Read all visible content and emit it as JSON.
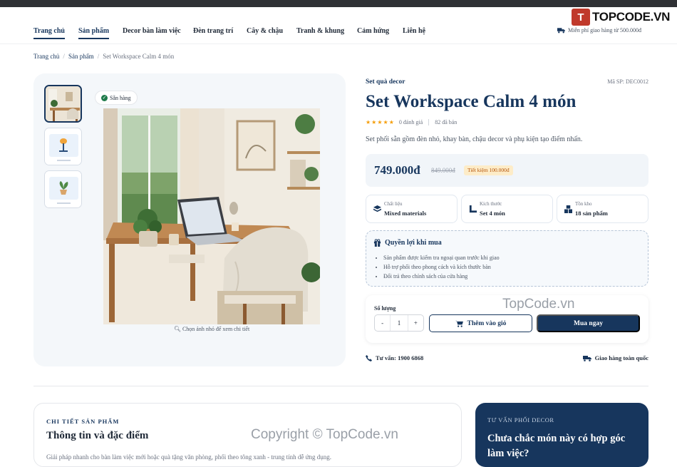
{
  "logo": {
    "mark": "T",
    "text": "TOPCODE.VN"
  },
  "nav": {
    "items": [
      "Trang chủ",
      "Sản phẩm",
      "Decor bàn làm việc",
      "Đèn trang trí",
      "Cây & chậu",
      "Tranh & khung",
      "Cảm hứng",
      "Liên hệ"
    ],
    "shipping_note": "Miễn phí giao hàng từ 500.000đ"
  },
  "breadcrumb": [
    "Trang chủ",
    "Sản phẩm",
    "Set Workspace Calm 4 món"
  ],
  "gallery": {
    "stock_badge": "Sẵn hàng",
    "hint": "Chọn ảnh nhỏ để xem chi tiết"
  },
  "product": {
    "category": "Set quà decor",
    "sku": "Mã SP: DEC0012",
    "title": "Set Workspace Calm 4 món",
    "stars": "★★★★★",
    "rating_value": 5,
    "reviews": "0 đánh giá",
    "sold": "82 đã bán",
    "description": "Set phối sẵn gồm đèn nhỏ, khay bàn, chậu decor và phụ kiện tạo điểm nhấn.",
    "price": "749.000đ",
    "old_price": "849.000đ",
    "saving": "Tiết kiệm 100.000đ",
    "stats": [
      {
        "key": "Chất liệu",
        "value": "Mixed materials",
        "icon": "layers-icon"
      },
      {
        "key": "Kích thước",
        "value": "Set 4 món",
        "icon": "ruler-icon"
      },
      {
        "key": "Tồn kho",
        "value": "18 sản phẩm",
        "icon": "boxes-icon"
      }
    ]
  },
  "benefits": {
    "title": "Quyền lợi khi mua",
    "items": [
      "Sản phẩm được kiểm tra ngoại quan trước khi giao",
      "Hỗ trợ phối theo phong cách và kích thước bàn",
      "Đổi trả theo chính sách của cửa hàng"
    ]
  },
  "purchase": {
    "qty_label": "Số lượng",
    "minus": "-",
    "qty": "1",
    "plus": "+",
    "add_to_cart": "Thêm vào giỏ",
    "buy_now": "Mua ngay"
  },
  "contact": {
    "hotline": "Tư vấn: 1900 6868",
    "delivery": "Giao hàng toàn quốc"
  },
  "detail": {
    "eyebrow": "CHI TIẾT SẢN PHẨM",
    "heading": "Thông tin và đặc điểm",
    "text": "Giải pháp nhanh cho bàn làm việc mới hoặc quà tặng văn phòng, phối theo tông xanh - trung tính dễ ứng dụng."
  },
  "advice": {
    "eyebrow": "TƯ VẤN PHỐI DECOR",
    "heading": "Chưa chắc món này có hợp góc làm việc?"
  },
  "watermarks": {
    "top": "TopCode.vn",
    "bottom": "Copyright © TopCode.vn"
  },
  "colors": {
    "primary": "#17365d",
    "star": "#f59e0b",
    "success": "#1e7a4a",
    "logo_red": "#c0392b"
  }
}
